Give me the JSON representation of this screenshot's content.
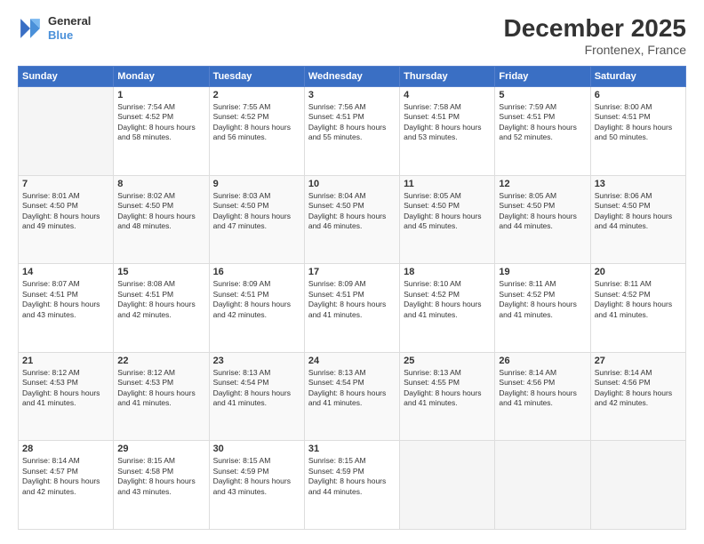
{
  "header": {
    "logo": {
      "line1": "General",
      "line2": "Blue"
    },
    "title": "December 2025",
    "subtitle": "Frontenex, France"
  },
  "weekdays": [
    "Sunday",
    "Monday",
    "Tuesday",
    "Wednesday",
    "Thursday",
    "Friday",
    "Saturday"
  ],
  "weeks": [
    [
      {
        "date": "",
        "sunrise": "",
        "sunset": "",
        "daylight": ""
      },
      {
        "date": "1",
        "sunrise": "Sunrise: 7:54 AM",
        "sunset": "Sunset: 4:52 PM",
        "daylight": "Daylight: 8 hours and 58 minutes."
      },
      {
        "date": "2",
        "sunrise": "Sunrise: 7:55 AM",
        "sunset": "Sunset: 4:52 PM",
        "daylight": "Daylight: 8 hours and 56 minutes."
      },
      {
        "date": "3",
        "sunrise": "Sunrise: 7:56 AM",
        "sunset": "Sunset: 4:51 PM",
        "daylight": "Daylight: 8 hours and 55 minutes."
      },
      {
        "date": "4",
        "sunrise": "Sunrise: 7:58 AM",
        "sunset": "Sunset: 4:51 PM",
        "daylight": "Daylight: 8 hours and 53 minutes."
      },
      {
        "date": "5",
        "sunrise": "Sunrise: 7:59 AM",
        "sunset": "Sunset: 4:51 PM",
        "daylight": "Daylight: 8 hours and 52 minutes."
      },
      {
        "date": "6",
        "sunrise": "Sunrise: 8:00 AM",
        "sunset": "Sunset: 4:51 PM",
        "daylight": "Daylight: 8 hours and 50 minutes."
      }
    ],
    [
      {
        "date": "7",
        "sunrise": "Sunrise: 8:01 AM",
        "sunset": "Sunset: 4:50 PM",
        "daylight": "Daylight: 8 hours and 49 minutes."
      },
      {
        "date": "8",
        "sunrise": "Sunrise: 8:02 AM",
        "sunset": "Sunset: 4:50 PM",
        "daylight": "Daylight: 8 hours and 48 minutes."
      },
      {
        "date": "9",
        "sunrise": "Sunrise: 8:03 AM",
        "sunset": "Sunset: 4:50 PM",
        "daylight": "Daylight: 8 hours and 47 minutes."
      },
      {
        "date": "10",
        "sunrise": "Sunrise: 8:04 AM",
        "sunset": "Sunset: 4:50 PM",
        "daylight": "Daylight: 8 hours and 46 minutes."
      },
      {
        "date": "11",
        "sunrise": "Sunrise: 8:05 AM",
        "sunset": "Sunset: 4:50 PM",
        "daylight": "Daylight: 8 hours and 45 minutes."
      },
      {
        "date": "12",
        "sunrise": "Sunrise: 8:05 AM",
        "sunset": "Sunset: 4:50 PM",
        "daylight": "Daylight: 8 hours and 44 minutes."
      },
      {
        "date": "13",
        "sunrise": "Sunrise: 8:06 AM",
        "sunset": "Sunset: 4:50 PM",
        "daylight": "Daylight: 8 hours and 44 minutes."
      }
    ],
    [
      {
        "date": "14",
        "sunrise": "Sunrise: 8:07 AM",
        "sunset": "Sunset: 4:51 PM",
        "daylight": "Daylight: 8 hours and 43 minutes."
      },
      {
        "date": "15",
        "sunrise": "Sunrise: 8:08 AM",
        "sunset": "Sunset: 4:51 PM",
        "daylight": "Daylight: 8 hours and 42 minutes."
      },
      {
        "date": "16",
        "sunrise": "Sunrise: 8:09 AM",
        "sunset": "Sunset: 4:51 PM",
        "daylight": "Daylight: 8 hours and 42 minutes."
      },
      {
        "date": "17",
        "sunrise": "Sunrise: 8:09 AM",
        "sunset": "Sunset: 4:51 PM",
        "daylight": "Daylight: 8 hours and 41 minutes."
      },
      {
        "date": "18",
        "sunrise": "Sunrise: 8:10 AM",
        "sunset": "Sunset: 4:52 PM",
        "daylight": "Daylight: 8 hours and 41 minutes."
      },
      {
        "date": "19",
        "sunrise": "Sunrise: 8:11 AM",
        "sunset": "Sunset: 4:52 PM",
        "daylight": "Daylight: 8 hours and 41 minutes."
      },
      {
        "date": "20",
        "sunrise": "Sunrise: 8:11 AM",
        "sunset": "Sunset: 4:52 PM",
        "daylight": "Daylight: 8 hours and 41 minutes."
      }
    ],
    [
      {
        "date": "21",
        "sunrise": "Sunrise: 8:12 AM",
        "sunset": "Sunset: 4:53 PM",
        "daylight": "Daylight: 8 hours and 41 minutes."
      },
      {
        "date": "22",
        "sunrise": "Sunrise: 8:12 AM",
        "sunset": "Sunset: 4:53 PM",
        "daylight": "Daylight: 8 hours and 41 minutes."
      },
      {
        "date": "23",
        "sunrise": "Sunrise: 8:13 AM",
        "sunset": "Sunset: 4:54 PM",
        "daylight": "Daylight: 8 hours and 41 minutes."
      },
      {
        "date": "24",
        "sunrise": "Sunrise: 8:13 AM",
        "sunset": "Sunset: 4:54 PM",
        "daylight": "Daylight: 8 hours and 41 minutes."
      },
      {
        "date": "25",
        "sunrise": "Sunrise: 8:13 AM",
        "sunset": "Sunset: 4:55 PM",
        "daylight": "Daylight: 8 hours and 41 minutes."
      },
      {
        "date": "26",
        "sunrise": "Sunrise: 8:14 AM",
        "sunset": "Sunset: 4:56 PM",
        "daylight": "Daylight: 8 hours and 41 minutes."
      },
      {
        "date": "27",
        "sunrise": "Sunrise: 8:14 AM",
        "sunset": "Sunset: 4:56 PM",
        "daylight": "Daylight: 8 hours and 42 minutes."
      }
    ],
    [
      {
        "date": "28",
        "sunrise": "Sunrise: 8:14 AM",
        "sunset": "Sunset: 4:57 PM",
        "daylight": "Daylight: 8 hours and 42 minutes."
      },
      {
        "date": "29",
        "sunrise": "Sunrise: 8:15 AM",
        "sunset": "Sunset: 4:58 PM",
        "daylight": "Daylight: 8 hours and 43 minutes."
      },
      {
        "date": "30",
        "sunrise": "Sunrise: 8:15 AM",
        "sunset": "Sunset: 4:59 PM",
        "daylight": "Daylight: 8 hours and 43 minutes."
      },
      {
        "date": "31",
        "sunrise": "Sunrise: 8:15 AM",
        "sunset": "Sunset: 4:59 PM",
        "daylight": "Daylight: 8 hours and 44 minutes."
      },
      {
        "date": "",
        "sunrise": "",
        "sunset": "",
        "daylight": ""
      },
      {
        "date": "",
        "sunrise": "",
        "sunset": "",
        "daylight": ""
      },
      {
        "date": "",
        "sunrise": "",
        "sunset": "",
        "daylight": ""
      }
    ]
  ]
}
